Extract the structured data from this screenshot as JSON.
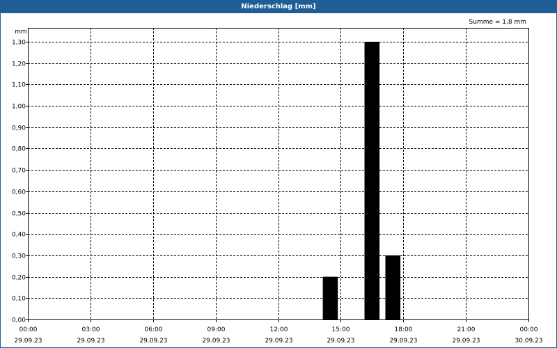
{
  "window": {
    "title": "Niederschlag [mm]"
  },
  "summary": "Summe = 1,8 mm",
  "colors": {
    "titlebar": "#1f5d95",
    "bar": "#000000",
    "grid": "#000000"
  },
  "chart_data": {
    "type": "bar",
    "ylabel": "mm",
    "ylim": [
      0,
      1.3
    ],
    "yticks": [
      "0,00",
      "0,10",
      "0,20",
      "0,30",
      "0,40",
      "0,50",
      "0,60",
      "0,70",
      "0,80",
      "0,90",
      "1,00",
      "1,10",
      "1,20",
      "1,30"
    ],
    "xlim": [
      "29.09.23 00:00",
      "30.09.23 00:00"
    ],
    "xticks": [
      {
        "time": "00:00",
        "date": "29.09.23"
      },
      {
        "time": "03:00",
        "date": "29.09.23"
      },
      {
        "time": "06:00",
        "date": "29.09.23"
      },
      {
        "time": "09:00",
        "date": "29.09.23"
      },
      {
        "time": "12:00",
        "date": "29.09.23"
      },
      {
        "time": "15:00",
        "date": "29.09.23"
      },
      {
        "time": "18:00",
        "date": "29.09.23"
      },
      {
        "time": "21:00",
        "date": "29.09.23"
      },
      {
        "time": "00:00",
        "date": "30.09.23"
      }
    ],
    "bars": [
      {
        "time": "29.09.23 14:00",
        "value": 0.2
      },
      {
        "time": "29.09.23 16:00",
        "value": 1.3
      },
      {
        "time": "29.09.23 17:00",
        "value": 0.3
      }
    ],
    "grid": true
  }
}
